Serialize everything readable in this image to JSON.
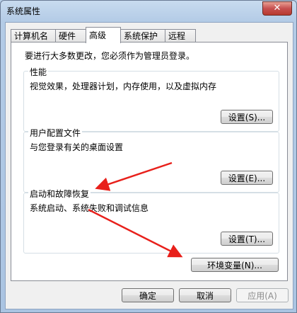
{
  "window": {
    "title": "系统属性",
    "close_label": "✕"
  },
  "tabs": [
    {
      "label": "计算机名"
    },
    {
      "label": "硬件"
    },
    {
      "label": "高级"
    },
    {
      "label": "系统保护"
    },
    {
      "label": "远程"
    }
  ],
  "active_tab": "高级",
  "admin_note": "要进行大多数更改，您必须作为管理员登录。",
  "performance": {
    "title": "性能",
    "desc": "视觉效果，处理器计划，内存使用，以及虚拟内存",
    "button": "设置(S)..."
  },
  "user_profiles": {
    "title": "用户配置文件",
    "desc": "与您登录有关的桌面设置",
    "button": "设置(E)..."
  },
  "startup_recovery": {
    "title": "启动和故障恢复",
    "desc": "系统启动、系统失败和调试信息",
    "button": "设置(T)..."
  },
  "env_button": "环境变量(N)...",
  "footer": {
    "ok": "确定",
    "cancel": "取消",
    "apply": "应用(A)"
  },
  "colors": {
    "arrow": "#e8201b",
    "accent": "#3c7fb1"
  }
}
